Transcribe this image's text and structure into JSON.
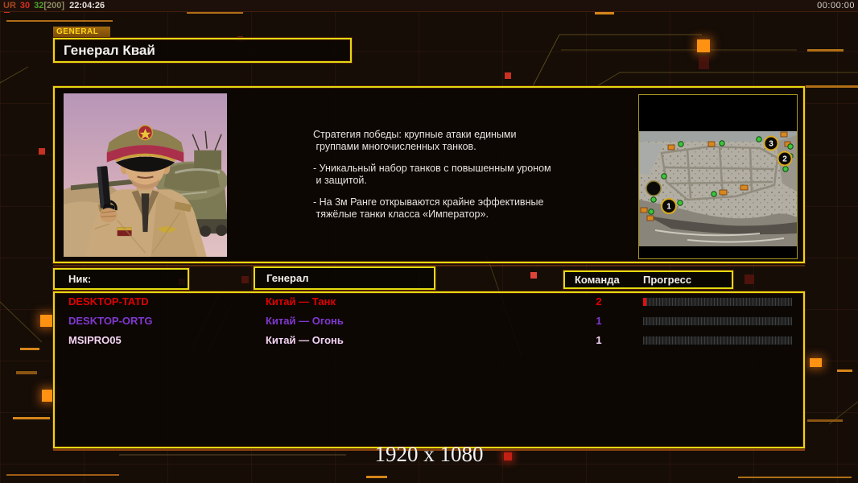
{
  "topbar": {
    "parts": [
      {
        "t": "UR",
        "c": "#a8481e"
      },
      {
        "t": "30",
        "c": "#d42f1e"
      },
      {
        "t": "32",
        "c": "#4ea32c"
      },
      {
        "t": "[200]",
        "c": "#8c8a66"
      },
      {
        "t": "22:04:26",
        "c": "#e2ded8"
      }
    ],
    "timer": "00:00:00"
  },
  "header": {
    "tab": "GENERAL",
    "title": "Генерал Квай"
  },
  "info": {
    "description": [
      "Стратегия победы: крупные атаки едиными\n группами многочисленных танков.",
      "- Уникальный набор танков с повышенным уроном\n и защитой.",
      "- На 3м Ранге открываются крайне эффективные\n тяжёлые танки класса «Император»."
    ]
  },
  "minimap": {
    "markers": [
      {
        "label": "1"
      },
      {
        "label": "2"
      },
      {
        "label": "3"
      }
    ]
  },
  "table": {
    "headers": {
      "nick": "Ник:",
      "general": "Генерал",
      "team": "Команда",
      "progress": "Прогресс"
    },
    "rows": [
      {
        "nick": "DESKTOP-TATD",
        "general": "Китай — Танк",
        "team": "2",
        "color": "#e00000",
        "fill": "#e01010",
        "progress_pct": 2
      },
      {
        "nick": "DESKTOP-ORTG",
        "general": "Китай — Огонь",
        "team": "1",
        "color": "#8038d0",
        "fill": "#e01010",
        "progress_pct": 0
      },
      {
        "nick": "MSIPRO05",
        "general": "Китай — Огонь",
        "team": "1",
        "color": "#f5d5f5",
        "fill": "#e01010",
        "progress_pct": 0
      }
    ]
  },
  "footer": {
    "resolution": "1920 x 1080"
  },
  "colors": {
    "accent_yellow": "#e3da10",
    "accent_orange": "#ff9212",
    "alert_red": "#c93122"
  }
}
